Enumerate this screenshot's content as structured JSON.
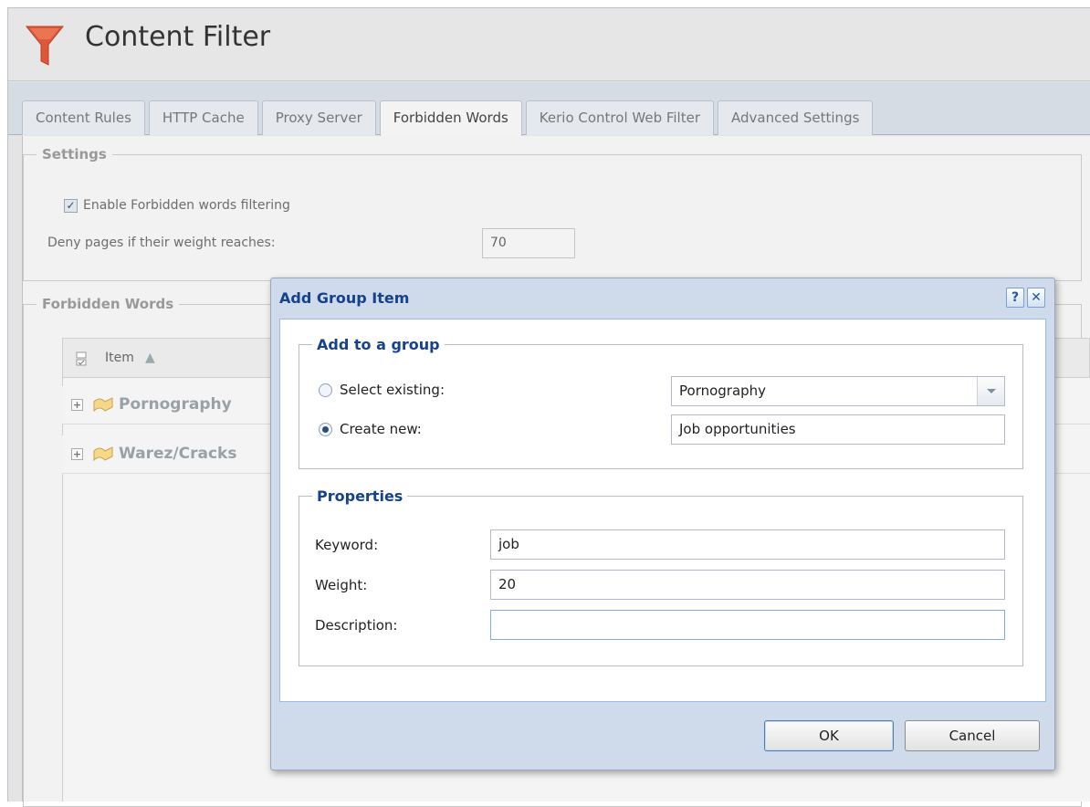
{
  "header": {
    "title": "Content Filter",
    "icon": "funnel-icon",
    "accent": "#e0563a"
  },
  "tabs": [
    {
      "label": "Content Rules",
      "active": false
    },
    {
      "label": "HTTP Cache",
      "active": false
    },
    {
      "label": "Proxy Server",
      "active": false
    },
    {
      "label": "Forbidden Words",
      "active": true
    },
    {
      "label": "Kerio Control Web Filter",
      "active": false
    },
    {
      "label": "Advanced Settings",
      "active": false
    }
  ],
  "settings": {
    "legend": "Settings",
    "enable_label": "Enable Forbidden words filtering",
    "enable_checked": true,
    "deny_label": "Deny pages if their weight reaches:",
    "deny_value": "70"
  },
  "forbidden": {
    "legend": "Forbidden Words",
    "column_item": "Item",
    "groups": [
      "Pornography",
      "Warez/Cracks"
    ]
  },
  "dialog": {
    "title": "Add Group Item",
    "group_legend": "Add to a group",
    "select_existing_label": "Select existing:",
    "select_existing_value": "Pornography",
    "create_new_label": "Create new:",
    "create_new_value": "Job opportunities",
    "selected_option": "create_new",
    "properties_legend": "Properties",
    "keyword_label": "Keyword:",
    "keyword_value": "job",
    "weight_label": "Weight:",
    "weight_value": "20",
    "description_label": "Description:",
    "description_value": "",
    "ok_label": "OK",
    "cancel_label": "Cancel"
  }
}
